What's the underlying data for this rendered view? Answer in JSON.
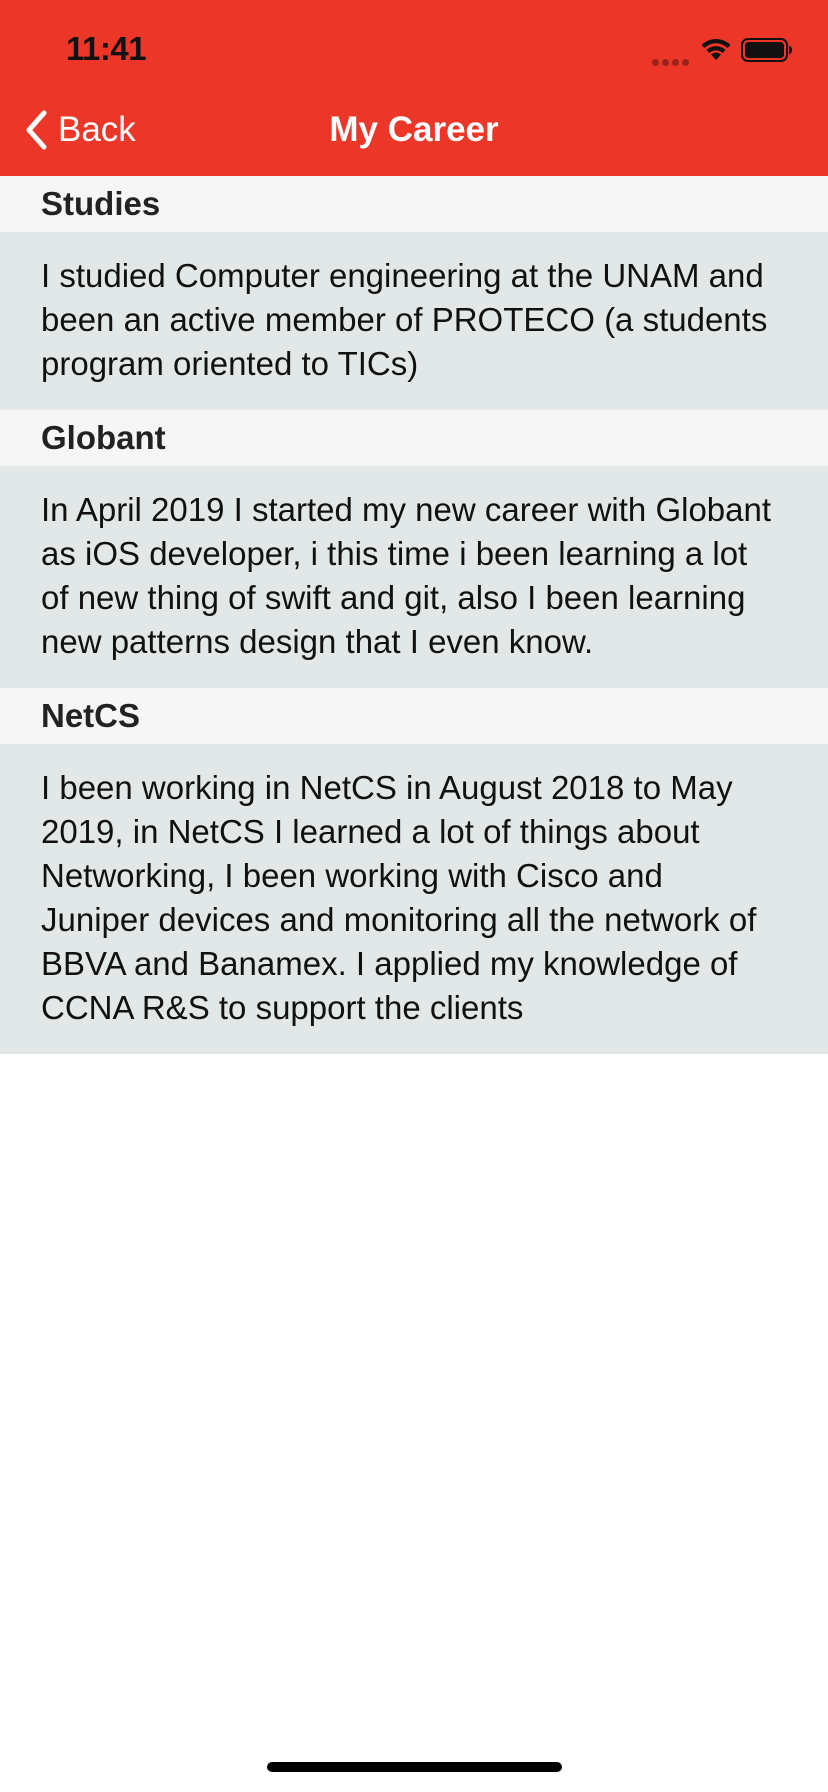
{
  "status_bar": {
    "time": "11:41"
  },
  "nav": {
    "back_label": "Back",
    "title": "My Career",
    "background_color": "#eb3628"
  },
  "sections": [
    {
      "header": "Studies",
      "body": "I studied Computer engineering at the UNAM and been an active member of PROTECO (a students program oriented to  TICs)"
    },
    {
      "header": "Globant",
      "body": "In April 2019 I started my new career with Globant as iOS developer, i this time i been learning a lot of new thing of swift and git, also I been learning new patterns design that I even know."
    },
    {
      "header": "NetCS",
      "body": "I been working in NetCS in August 2018 to May 2019, in NetCS I learned a lot of things about Networking, I been working with Cisco and Juniper devices and monitoring all the network of BBVA and Banamex. I applied my knowledge of CCNA R&S to support the clients"
    }
  ],
  "icons": {
    "back": "chevron-left-icon",
    "wifi": "wifi-icon",
    "battery": "battery-icon",
    "signal": "signal-dots-icon"
  }
}
